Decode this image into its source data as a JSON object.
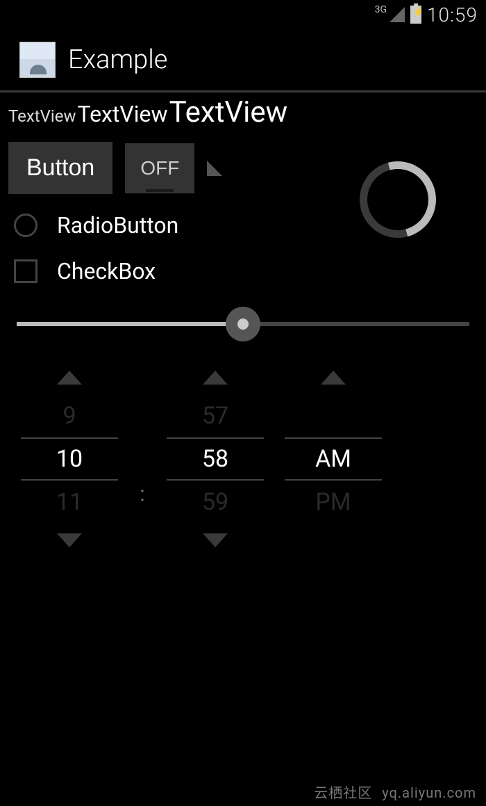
{
  "status": {
    "network_label": "3G",
    "time": "10:59"
  },
  "app": {
    "title": "Example"
  },
  "texts": {
    "small": "TextView",
    "medium": "TextView",
    "large": "TextView"
  },
  "controls": {
    "button_label": "Button",
    "toggle_label": "OFF",
    "radio_label": "RadioButton",
    "checkbox_label": "CheckBox",
    "seek_value_pct": 50
  },
  "time_picker": {
    "hour": {
      "prev": "9",
      "cur": "10",
      "next": "11"
    },
    "minute": {
      "prev": "57",
      "cur": "58",
      "next": "59"
    },
    "ampm": {
      "prev": "",
      "cur": "AM",
      "next": "PM"
    },
    "separator": ":"
  },
  "watermark": {
    "label": "云栖社区",
    "url_text": "yq.aliyun.com"
  }
}
